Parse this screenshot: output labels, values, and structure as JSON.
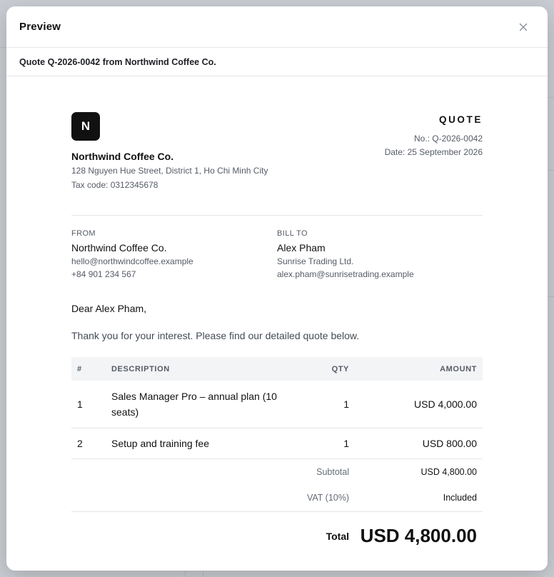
{
  "modal": {
    "title": "Preview",
    "close_icon": "close-icon",
    "subtitle": "Quote Q-2026-0042 from Northwind Coffee Co."
  },
  "document": {
    "logo_letter": "N",
    "company": {
      "name": "Northwind Coffee Co.",
      "address": "128 Nguyen Hue Street, District 1, Ho Chi Minh City",
      "tax_code": "Tax code: 0312345678"
    },
    "type_label": "QUOTE",
    "number": "No.: Q-2026-0042",
    "date": "Date: 25 September 2026",
    "from": {
      "label": "FROM",
      "name": "Northwind Coffee Co.",
      "email": "hello@northwindcoffee.example",
      "phone": "+84 901 234 567"
    },
    "bill_to": {
      "label": "BILL TO",
      "name": "Alex Pham",
      "company": "Sunrise Trading Ltd.",
      "email": "alex.pham@sunrisetrading.example"
    },
    "greeting": "Dear Alex Pham,",
    "intro": "Thank you for your interest. Please find our detailed quote below.",
    "table": {
      "headers": {
        "num": "#",
        "description": "DESCRIPTION",
        "qty": "QTY",
        "amount": "AMOUNT"
      },
      "rows": [
        {
          "num": "1",
          "description": "Sales Manager Pro – annual plan (10 seats)",
          "qty": "1",
          "amount": "USD 4,000.00"
        },
        {
          "num": "2",
          "description": "Setup and training fee",
          "qty": "1",
          "amount": "USD 800.00"
        }
      ]
    },
    "summary": {
      "subtotal_label": "Subtotal",
      "subtotal_value": "USD 4,800.00",
      "vat_label": "VAT (10%)",
      "vat_value": "Included",
      "total_label": "Total",
      "total_value": "USD 4,800.00"
    }
  }
}
